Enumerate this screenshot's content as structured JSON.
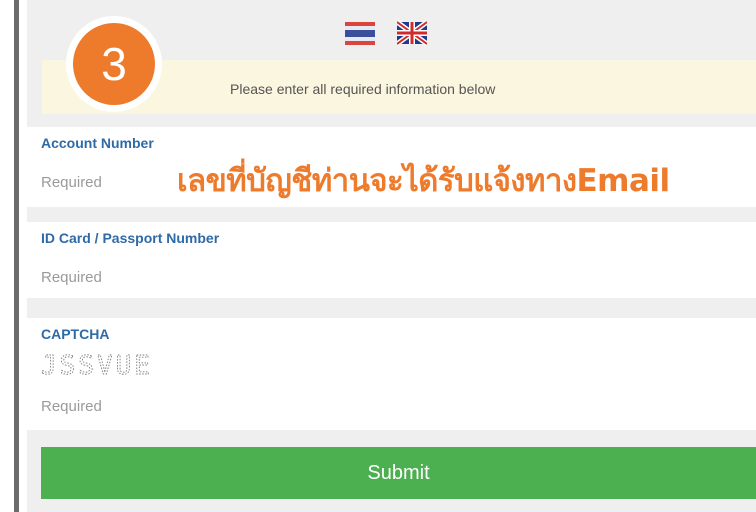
{
  "language_flags": {
    "items": [
      {
        "name": "thailand-flag-icon",
        "colors": [
          "#d9463e",
          "#e8e8f5",
          "#3a4f9c"
        ]
      },
      {
        "name": "uk-flag-icon",
        "colors": [
          "#1f3c8c",
          "#ffffff",
          "#d12a2a"
        ]
      }
    ]
  },
  "step_badge": {
    "number": "3",
    "color": "#ee7a2c"
  },
  "notice": {
    "text": "Please enter all required information below"
  },
  "fields": {
    "account_number": {
      "label": "Account Number",
      "placeholder": "Required",
      "annotation": "เลขที่บัญชีท่านจะได้รับแจ้งทางEmail"
    },
    "id_card": {
      "label": "ID Card / Passport Number",
      "placeholder": "Required"
    },
    "captcha": {
      "label": "CAPTCHA",
      "image_text": "JSSVUE",
      "placeholder": "Required"
    }
  },
  "submit": {
    "label": "Submit",
    "color": "#4caf50"
  }
}
